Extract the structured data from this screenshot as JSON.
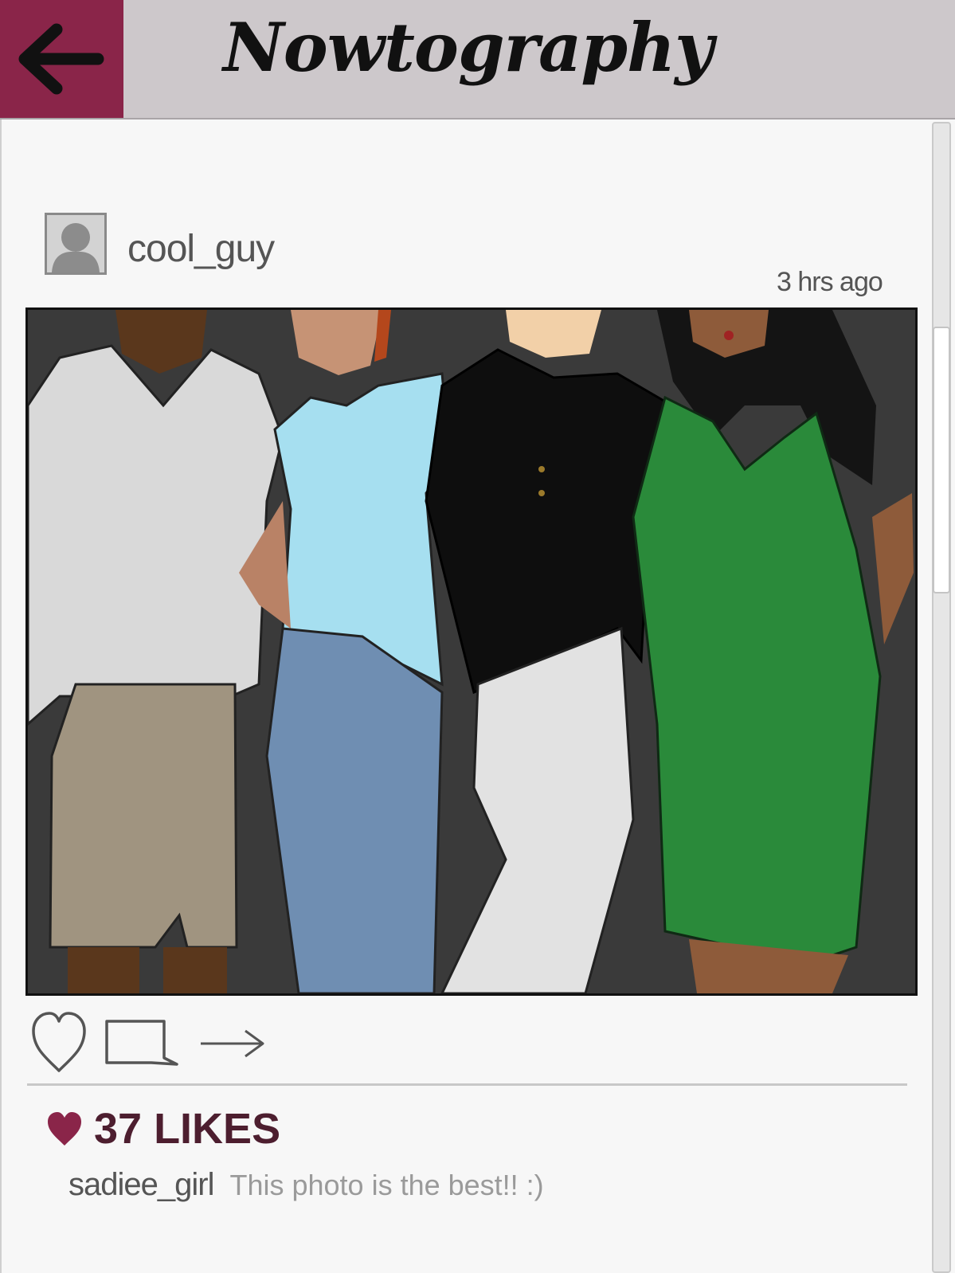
{
  "header": {
    "app_title": "Nowtography",
    "back_icon": "arrow-left-icon",
    "colors": {
      "bar": "#cdc8cb",
      "back_button": "#8a2549"
    }
  },
  "post": {
    "username": "cool_guy",
    "timestamp": "3 hrs ago",
    "avatar_icon": "default-user-avatar",
    "actions": [
      {
        "icon": "heart-outline-icon"
      },
      {
        "icon": "comment-icon"
      },
      {
        "icon": "share-arrow-icon"
      }
    ],
    "likes": "37 LIKES",
    "likes_icon": "heart-filled-icon",
    "accent_color": "#8a2549",
    "comments": [
      {
        "user": "sadiee_girl",
        "text": "This photo is the best!! :)"
      }
    ]
  }
}
